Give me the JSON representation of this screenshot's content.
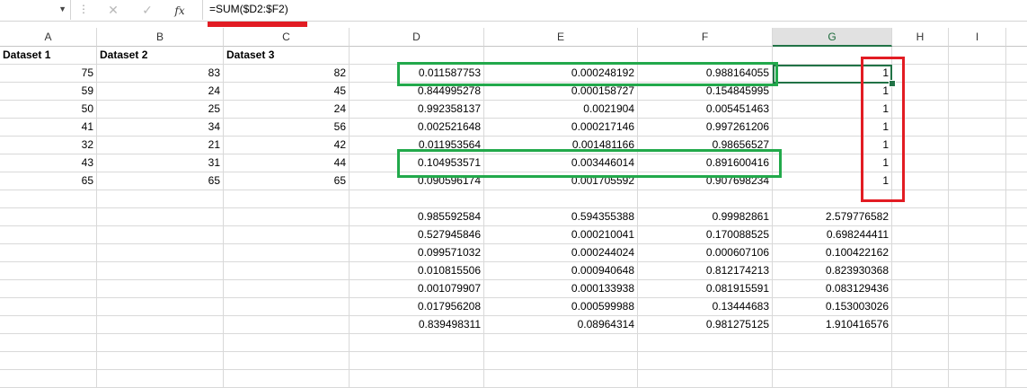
{
  "formula_bar": {
    "cancel_icon": "x-icon",
    "enter_icon": "check-icon",
    "fx_label": "fx",
    "formula": "=SUM($D2:$F2)"
  },
  "columns": [
    "A",
    "B",
    "C",
    "D",
    "E",
    "F",
    "G",
    "H",
    "I"
  ],
  "selected_column": "G",
  "headers": [
    "Dataset 1",
    "Dataset 2",
    "Dataset 3"
  ],
  "rows": [
    [
      "75",
      "83",
      "82",
      "0.011587753",
      "0.000248192",
      "0.988164055",
      "1"
    ],
    [
      "59",
      "24",
      "45",
      "0.844995278",
      "0.000158727",
      "0.154845995",
      "1"
    ],
    [
      "50",
      "25",
      "24",
      "0.992358137",
      "0.0021904",
      "0.005451463",
      "1"
    ],
    [
      "41",
      "34",
      "56",
      "0.002521648",
      "0.000217146",
      "0.997261206",
      "1"
    ],
    [
      "32",
      "21",
      "42",
      "0.011953564",
      "0.001481166",
      "0.98656527",
      "1"
    ],
    [
      "43",
      "31",
      "44",
      "0.104953571",
      "0.003446014",
      "0.891600416",
      "1"
    ],
    [
      "65",
      "65",
      "65",
      "0.090596174",
      "0.001705592",
      "0.907698234",
      "1"
    ]
  ],
  "lower_rows": [
    [
      "0.985592584",
      "0.594355388",
      "0.99982861",
      "2.579776582"
    ],
    [
      "0.527945846",
      "0.000210041",
      "0.170088525",
      "0.698244411"
    ],
    [
      "0.099571032",
      "0.000244024",
      "0.000607106",
      "0.100422162"
    ],
    [
      "0.010815506",
      "0.000940648",
      "0.812174213",
      "0.823930368"
    ],
    [
      "0.001079907",
      "0.000133938",
      "0.081915591",
      "0.083129436"
    ],
    [
      "0.017956208",
      "0.000599988",
      "0.13444683",
      "0.153003026"
    ],
    [
      "0.839498311",
      "0.08964314",
      "0.981275125",
      "1.910416576"
    ]
  ],
  "colors": {
    "green_highlight": "#22a94b",
    "red_highlight": "#e21c23",
    "excel_green": "#217346"
  }
}
